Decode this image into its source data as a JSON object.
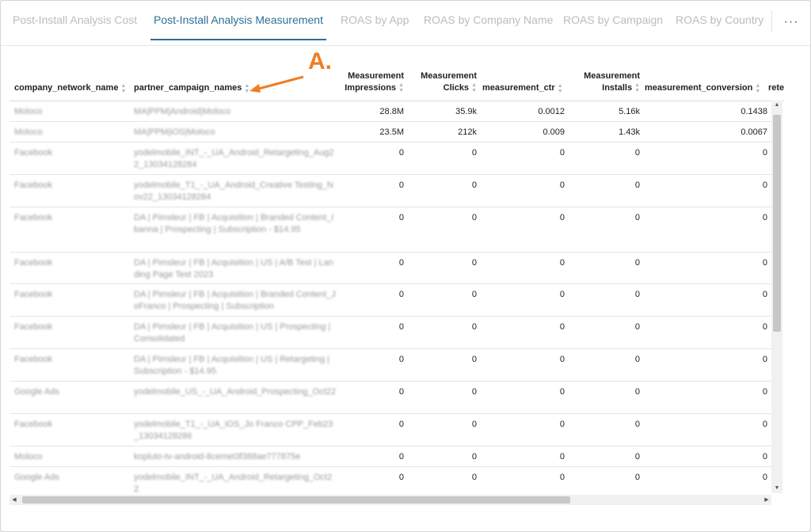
{
  "tabs": [
    {
      "label": "Post-Install Analysis Cost",
      "active": false
    },
    {
      "label": "Post-Install Analysis Measurement",
      "active": true
    },
    {
      "label": "ROAS by App",
      "active": false
    },
    {
      "label": "ROAS by Company Name",
      "active": false
    },
    {
      "label": "ROAS by Campaign",
      "active": false
    },
    {
      "label": "ROAS by Country",
      "active": false
    }
  ],
  "more_label": "···",
  "annotation": {
    "label": "A.",
    "color": "#ef7d22"
  },
  "columns": [
    {
      "l1": "",
      "l2": "company_network_name"
    },
    {
      "l1": "",
      "l2": "partner_campaign_names"
    },
    {
      "l1": "Measurement",
      "l2": "Impressions"
    },
    {
      "l1": "Measurement",
      "l2": "Clicks"
    },
    {
      "l1": "",
      "l2": "measurement_ctr"
    },
    {
      "l1": "Measurement",
      "l2": "Installs"
    },
    {
      "l1": "",
      "l2": "measurement_conversion"
    },
    {
      "l1": "",
      "l2": "rete"
    }
  ],
  "rows": [
    {
      "company": "Moloco",
      "campaign": "MA|PPM|Android|Moloco",
      "impressions": "28.8M",
      "clicks": "35.9k",
      "ctr": "0.0012",
      "installs": "5.16k",
      "conversion": "0.1438"
    },
    {
      "company": "Moloco",
      "campaign": "MA|PPM|iOS|Moloco",
      "impressions": "23.5M",
      "clicks": "212k",
      "ctr": "0.009",
      "installs": "1.43k",
      "conversion": "0.0067"
    },
    {
      "company": "Facebook",
      "campaign": "yodelmobile_INT_-_UA_Android_Retargeting_Aug22_13034128284",
      "impressions": "0",
      "clicks": "0",
      "ctr": "0",
      "installs": "0",
      "conversion": "0"
    },
    {
      "company": "Facebook",
      "campaign": "yodelmobile_T1_-_UA_Android_Creative Testing_Nov22_13034128284",
      "impressions": "0",
      "clicks": "0",
      "ctr": "0",
      "installs": "0",
      "conversion": "0"
    },
    {
      "company": "Facebook",
      "campaign": "DA | Pimsleur | FB | Acquisition | Branded Content_Ibanna | Prospecting | Subscription - $14.95",
      "impressions": "0",
      "clicks": "0",
      "ctr": "0",
      "installs": "0",
      "conversion": "0"
    },
    {
      "company": "Facebook",
      "campaign": "DA | Pimsleur | FB | Acquisition | US | A/B Test | Landing Page Test 2023",
      "impressions": "0",
      "clicks": "0",
      "ctr": "0",
      "installs": "0",
      "conversion": "0"
    },
    {
      "company": "Facebook",
      "campaign": "DA | Pimsleur | FB | Acquisition | Branded Content_JoFranco | Prospecting | Subscription",
      "impressions": "0",
      "clicks": "0",
      "ctr": "0",
      "installs": "0",
      "conversion": "0"
    },
    {
      "company": "Facebook",
      "campaign": "DA | Pimsleur | FB | Acquisition | US | Prospecting | Consolidated",
      "impressions": "0",
      "clicks": "0",
      "ctr": "0",
      "installs": "0",
      "conversion": "0"
    },
    {
      "company": "Facebook",
      "campaign": "DA | Pimsleur | FB | Acquisition | US | Retargeting | Subscription - $14.95",
      "impressions": "0",
      "clicks": "0",
      "ctr": "0",
      "installs": "0",
      "conversion": "0"
    },
    {
      "company": "Google Ads",
      "campaign": "yodelmobile_US_-_UA_Android_Prospecting_Oct22",
      "impressions": "0",
      "clicks": "0",
      "ctr": "0",
      "installs": "0",
      "conversion": "0"
    },
    {
      "company": "Facebook",
      "campaign": "yodelmobile_T1_-_UA_iOS_Jo Franco CPP_Feb23_13034128286",
      "impressions": "0",
      "clicks": "0",
      "ctr": "0",
      "installs": "0",
      "conversion": "0"
    },
    {
      "company": "Moloco",
      "campaign": "kopluto-tv-android-8cemet3f388ae777875e",
      "impressions": "0",
      "clicks": "0",
      "ctr": "0",
      "installs": "0",
      "conversion": "0"
    },
    {
      "company": "Google Ads",
      "campaign": "yodelmobile_INT_-_UA_Android_Retargeting_Oct22",
      "impressions": "0",
      "clicks": "0",
      "ctr": "0",
      "installs": "0",
      "conversion": "0"
    }
  ]
}
